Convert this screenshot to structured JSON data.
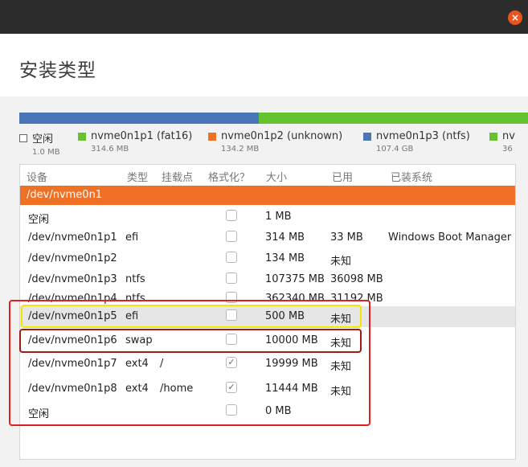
{
  "window": {
    "close_glyph": "×",
    "title": "安装类型"
  },
  "colors": {
    "accent": "#e95420",
    "device_row": "#f07126",
    "free": "#ffffff",
    "fat16": "#67c22f",
    "unknown": "#f07126",
    "ntfs": "#4a76b8",
    "ext4": "#67c22f",
    "highlight_yellow": "#f5e600",
    "highlight_red": "#e02020"
  },
  "partition_bar": {
    "segments": [
      {
        "name": "ntfs",
        "color": "#4a76b8",
        "fraction": 0.47
      },
      {
        "name": "ext4",
        "color": "#67c22f",
        "fraction": 0.53
      }
    ]
  },
  "legend": [
    {
      "label": "空闲",
      "size": "1.0 MB",
      "swatch": "#ffffff"
    },
    {
      "label": "nvme0n1p1 (fat16)",
      "size": "314.6 MB",
      "swatch": "#67c22f"
    },
    {
      "label": "nvme0n1p2 (unknown)",
      "size": "134.2 MB",
      "swatch": "#f07126"
    },
    {
      "label": "nvme0n1p3 (ntfs)",
      "size": "107.4 GB",
      "swatch": "#4a76b8"
    },
    {
      "label": "nv",
      "size": "36",
      "swatch": "#67c22f"
    }
  ],
  "table": {
    "headers": {
      "device": "设备",
      "type": "类型",
      "mount": "挂载点",
      "format": "格式化？",
      "size": "大小",
      "used": "已用",
      "system": "已装系统"
    },
    "device_group": "/dev/nvme0n1",
    "rows": [
      {
        "device": "空闲",
        "type": "",
        "mount": "",
        "format": false,
        "size": "1 MB",
        "used": "",
        "system": ""
      },
      {
        "device": "/dev/nvme0n1p1",
        "type": "efi",
        "mount": "",
        "format": false,
        "size": "314 MB",
        "used": "33 MB",
        "system": "Windows Boot Manager"
      },
      {
        "device": "/dev/nvme0n1p2",
        "type": "",
        "mount": "",
        "format": false,
        "size": "134 MB",
        "used": "未知",
        "system": ""
      },
      {
        "device": "/dev/nvme0n1p3",
        "type": "ntfs",
        "mount": "",
        "format": false,
        "size": "107375 MB",
        "used": "36098 MB",
        "system": ""
      },
      {
        "device": "/dev/nvme0n1p4",
        "type": "ntfs",
        "mount": "",
        "format": false,
        "size": "362340 MB",
        "used": "31192 MB",
        "system": ""
      },
      {
        "device": "/dev/nvme0n1p5",
        "type": "efi",
        "mount": "",
        "format": false,
        "size": "500 MB",
        "used": "未知",
        "system": "",
        "selected": true
      },
      {
        "device": "/dev/nvme0n1p6",
        "type": "swap",
        "mount": "",
        "format": false,
        "size": "10000 MB",
        "used": "未知",
        "system": ""
      },
      {
        "device": "/dev/nvme0n1p7",
        "type": "ext4",
        "mount": "/",
        "format": true,
        "size": "19999 MB",
        "used": "未知",
        "system": ""
      },
      {
        "device": "/dev/nvme0n1p8",
        "type": "ext4",
        "mount": "/home",
        "format": true,
        "size": "11444 MB",
        "used": "未知",
        "system": ""
      },
      {
        "device": "空闲",
        "type": "",
        "mount": "",
        "format": false,
        "size": "0 MB",
        "used": "",
        "system": ""
      }
    ]
  },
  "checkmark_glyph": "✓"
}
